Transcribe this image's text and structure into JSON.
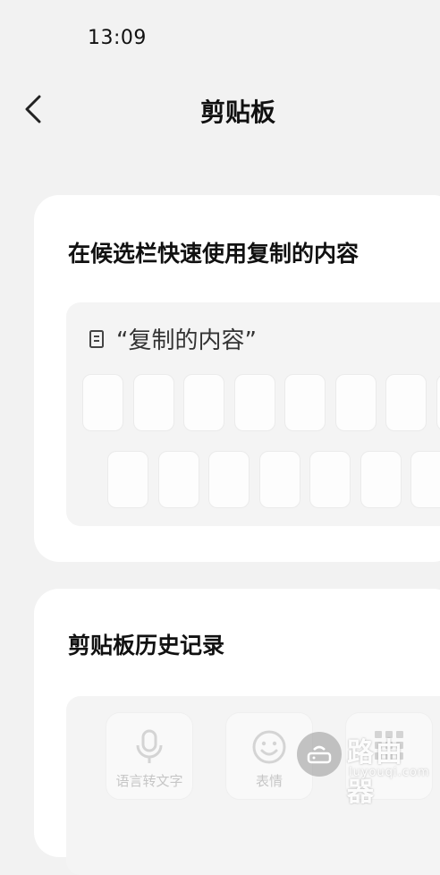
{
  "status_bar": {
    "time": "13:09"
  },
  "header": {
    "title": "剪贴板",
    "back_icon": "chevron-left-icon"
  },
  "candidate_section": {
    "title": "在候选栏快速使用复制的内容",
    "candidate_text": "“复制的内容”",
    "candidate_icon": "clipboard-icon"
  },
  "history_section": {
    "title": "剪贴板历史记录",
    "tools": [
      {
        "label": "语言转文字",
        "icon": "microphone-icon"
      },
      {
        "label": "表情",
        "icon": "smiley-icon"
      },
      {
        "label": "",
        "icon": "keypad-icon"
      }
    ]
  },
  "watermark": {
    "text": "路由器",
    "sub": "luyouqi.com",
    "icon": "router-icon"
  },
  "colors": {
    "background": "#f2f2f2",
    "card": "#ffffff",
    "keyboard": "#f4f4f4"
  }
}
